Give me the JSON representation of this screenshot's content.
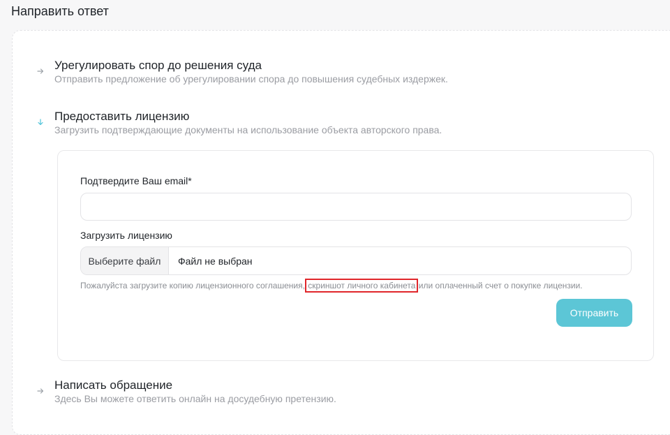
{
  "page": {
    "title": "Направить ответ"
  },
  "options": [
    {
      "title": "Урегулировать спор до решения суда",
      "description": "Отправить предложение об урегулировании спора до повышения судебных издержек."
    },
    {
      "title": "Предоставить лицензию",
      "description": "Загрузить подтверждающие документы на использование объекта авторского права."
    },
    {
      "title": "Написать обращение",
      "description": "Здесь Вы можете ответить онлайн на досудебную претензию."
    }
  ],
  "license_form": {
    "email_label": "Подтвердите Ваш email*",
    "email_value": "",
    "email_placeholder": "",
    "upload_label": "Загрузить лицензию",
    "file_button_label": "Выберите файл",
    "file_status": "Файл не выбран",
    "hint_before": "Пожалуйста загрузите копию лицензионного соглашения, ",
    "hint_highlight": "скриншот личного кабинета",
    "hint_after": " или оплаченный счет о покупке лицензии.",
    "submit_label": "Отправить"
  },
  "icons": {
    "collapsed": "chevron-right-icon",
    "expanded": "chevron-down-icon"
  },
  "colors": {
    "accent": "#5cc6d6",
    "highlight_border": "#e0262b"
  }
}
